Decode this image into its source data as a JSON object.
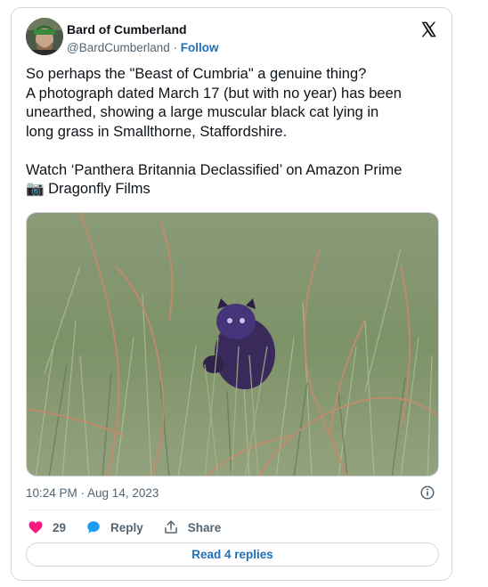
{
  "tweet": {
    "author_name": "Bard of Cumberland",
    "author_handle": "@BardCumberland",
    "separator": " · ",
    "follow_label": "Follow",
    "text_lines": [
      "So perhaps the \"Beast of Cumbria\" a genuine thing?",
      "A photograph dated March 17 (but with no year) has been",
      "unearthed, showing a large muscular black cat lying in",
      "long grass in Smallthorne, Staffordshire."
    ],
    "promo_line": "Watch ‘Panthera Britannia Declassified’ on Amazon Prime",
    "credit_emoji": "📷",
    "credit_text": "Dragonfly Films",
    "timestamp": "10:24 PM · Aug 14, 2023",
    "likes_count": "29",
    "reply_label": "Reply",
    "share_label": "Share",
    "read_replies_label": "Read 4 replies"
  },
  "icons": {
    "logo": "x-logo-icon",
    "info": "info-icon",
    "like": "heart-icon",
    "reply": "speech-bubble-icon",
    "share": "share-icon"
  },
  "colors": {
    "link": "#1d6fb8",
    "like": "#f91880",
    "reply": "#1d9bf0",
    "secondary_text": "#536471",
    "border": "#cfd9de"
  }
}
